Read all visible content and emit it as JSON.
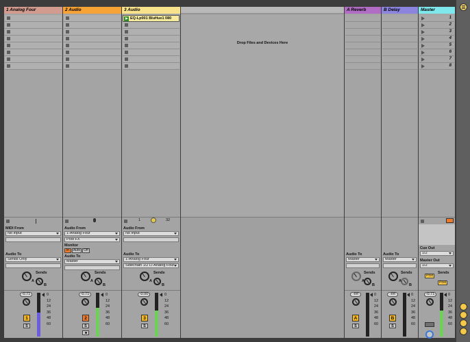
{
  "tracks": [
    {
      "name": "1 Analog Four",
      "color": "#d29b8f",
      "type": "midi",
      "input_label": "MIDI From",
      "input_value": "No Input",
      "output_label": "Audio To",
      "output_value": "Sends Only",
      "volume": "-0.71",
      "number": "1",
      "number_color": "#f6b61c",
      "meter_color": "#6b5ce0",
      "meter_level": 0.55
    },
    {
      "name": "2 Audio",
      "color": "#f7a234",
      "type": "audio",
      "input_label": "Audio From",
      "input_value": "1-Analog Four",
      "input_sub": "Post FX",
      "monitor_label": "Monitor",
      "monitor_options": [
        "In",
        "Auto",
        "Off"
      ],
      "output_label": "Audio To",
      "output_value": "Master",
      "volume": "-0.71",
      "number": "2",
      "number_color": "#ef7a2a",
      "meter_color": "#6fcf5b",
      "meter_level": 0.65
    },
    {
      "name": "3 Audio",
      "color": "#f8e38c",
      "type": "audio",
      "clip": "EQ-Lp001 BluHue1 080",
      "loop_start": "1",
      "loop_end": "32",
      "input_label": "Audio From",
      "input_value": "No Input",
      "output_label": "Audio To",
      "output_value": "1-Analog Four",
      "output_sub": "Sidechain 1/2 L/-Analog Four",
      "volume": "-0.00",
      "number": "3",
      "number_color": "#f6b61c",
      "meter_color": "#6fcf5b",
      "meter_level": 0.6
    }
  ],
  "drop_text": "Drop Files and Devices Here",
  "returns": [
    {
      "name": "A Reverb",
      "color": "#b16cc4",
      "output_label": "Audio To",
      "output_value": "Master",
      "volume": "-Inf",
      "letter": "A",
      "letter_color": "#f6b61c"
    },
    {
      "name": "B Delay",
      "color": "#8c85e0",
      "output_label": "Audio To",
      "output_value": "Master",
      "volume": "-Inf",
      "letter": "B",
      "letter_color": "#f6b61c"
    }
  ],
  "master": {
    "name": "Master",
    "color": "#7fe8ec",
    "scenes": [
      "1",
      "2",
      "3",
      "4",
      "5",
      "6",
      "7",
      "8"
    ],
    "cue_label": "Cue Out",
    "cue_value": "1/2",
    "master_out_label": "Master Out",
    "master_out_value": "1/2",
    "post_label": "Post",
    "volume": "-0.71",
    "meter_color": "#6fcf5b",
    "meter_level": 0.6
  },
  "sends_label": "Sends",
  "send_a": "A",
  "send_b": "B",
  "solo_label": "S",
  "meter_scale": [
    "0",
    "12",
    "24",
    "36",
    "48",
    "60"
  ]
}
